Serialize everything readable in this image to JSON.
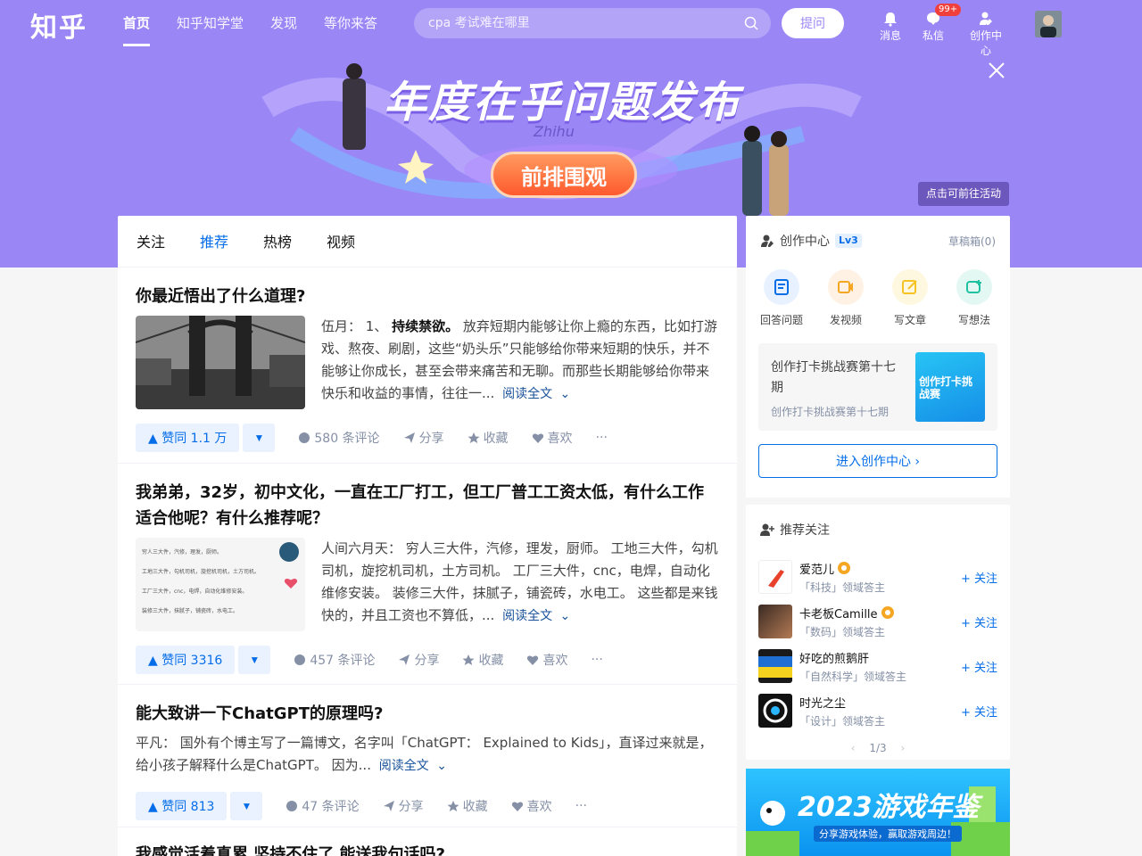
{
  "header": {
    "logo": "知乎",
    "nav": [
      "首页",
      "知乎知学堂",
      "发现",
      "等你来答"
    ],
    "search_placeholder": "cpa 考试难在哪里",
    "ask_label": "提问",
    "messages_label": "消息",
    "dm_label": "私信",
    "dm_badge": "99+",
    "creator_label": "创作中心"
  },
  "banner": {
    "title": "年度在乎问题发布",
    "subtitle": "Zhihu",
    "button": "前排围观",
    "link": "点击可前往活动"
  },
  "feed": {
    "tabs": [
      "关注",
      "推荐",
      "热榜",
      "视频"
    ],
    "active_tab": "推荐",
    "read_more": "阅读全文",
    "items": [
      {
        "title": "你最近悟出了什么道理?",
        "author": "伍月：",
        "excerpt_bold": "持续禁欲。",
        "excerpt_prefix": "1、",
        "excerpt": "放弃短期内能够让你上瘾的东西，比如打游戏、熬夜、刷剧，这些“奶头乐”只能够给你带来短期的快乐，并不能够让你成长，甚至会带来痛苦和无聊。而那些长期能够给你带来快乐和收益的事情，往往一...",
        "votes": "赞同 1.1 万",
        "comments": "580 条评论",
        "share": "分享",
        "favorite": "收藏",
        "like": "喜欢"
      },
      {
        "title": "我弟弟，32岁，初中文化，一直在工厂打工，但工厂普工工资太低，有什么工作适合他呢？有什么推荐呢？",
        "author": "人间六月天：",
        "excerpt": "穷人三大件，汽修，理发，厨师。 工地三大件，勾机司机，旋挖机司机，土方司机。 工厂三大件，cnc，电焊，自动化维修安装。 装修三大件，抹腻子，铺瓷砖，水电工。 这些都是来钱快的，并且工资也不算低，...",
        "votes": "赞同 3316",
        "comments": "457 条评论",
        "share": "分享",
        "favorite": "收藏",
        "like": "喜欢",
        "thumb_lines": [
          "穷人三大件，汽修，理发，厨师。",
          "工地三大件，勾机司机，旋挖机司机，土方司机。",
          "工厂三大件，cnc，电焊，自动化维修安装。",
          "装修三大件，抹腻子，铺瓷砖，水电工。"
        ]
      },
      {
        "title": "能大致讲一下ChatGPT的原理吗?",
        "author": "平凡：",
        "excerpt": "国外有个博主写了一篇博文，名字叫「ChatGPT： Explained to Kids」，直译过来就是，给小孩子解释什么是ChatGPT。 因为...",
        "votes": "赞同 813",
        "comments": "47 条评论",
        "share": "分享",
        "favorite": "收藏",
        "like": "喜欢"
      },
      {
        "title": "我感觉活着真累 坚持不住了 能送我句话吗?"
      }
    ]
  },
  "creator": {
    "title": "创作中心",
    "level": "Lv3",
    "drafts": "草稿箱(0)",
    "tools": [
      "回答问题",
      "发视频",
      "写文章",
      "写想法"
    ],
    "promo_title": "创作打卡挑战赛第十七期",
    "promo_sub": "创作打卡挑战赛第十七期",
    "promo_img_text": "创作打卡挑战赛",
    "enter": "进入创作中心 ›"
  },
  "recommend": {
    "title": "推荐关注",
    "follow_label": "+ 关注",
    "pager": "1/3",
    "users": [
      {
        "name": "爱范儿",
        "desc": "「科技」领域答主"
      },
      {
        "name": "卡老板Camille",
        "desc": "「数码」领域答主"
      },
      {
        "name": "好吃的煎鹅肝",
        "desc": "「自然科学」领域答主"
      },
      {
        "name": "时光之尘",
        "desc": "「设计」领域答主"
      }
    ]
  },
  "game_banner": {
    "title": "2023游戏年鉴",
    "sub": "分享游戏体验，赢取游戏周边！"
  }
}
